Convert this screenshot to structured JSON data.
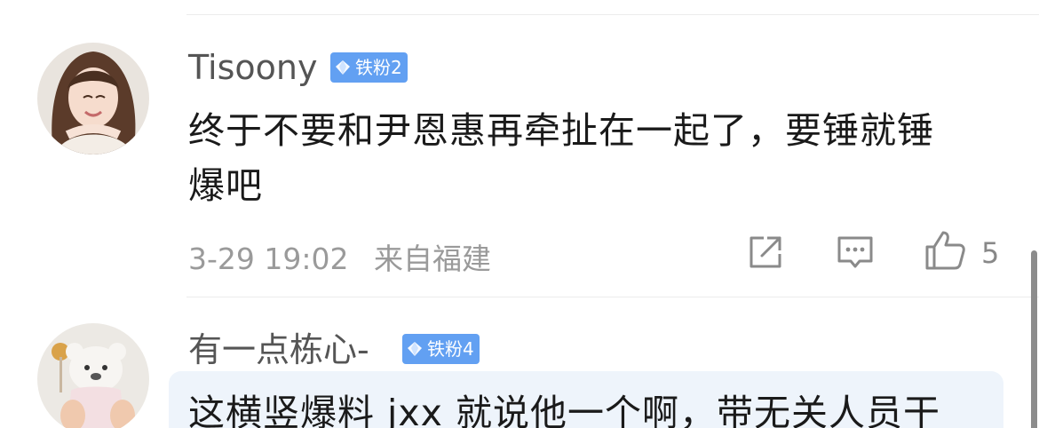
{
  "comments": [
    {
      "username": "Tisoony",
      "badge": "铁粉2",
      "text_line1": "终于不要和尹恩惠再牵扯在一起了，要锤就锤",
      "text_line2": "爆吧",
      "date": "3-29 19:02",
      "location": "来自福建",
      "likes": "5"
    },
    {
      "username": "有一点栋心-",
      "badge": "铁粉4",
      "text_line1": "这横竖爆料 jxx 就说他一个啊，带无关人员干"
    }
  ],
  "icons": {
    "share": "share-icon",
    "comment": "comment-icon",
    "like": "like-icon",
    "badge": "diamond-icon"
  },
  "colors": {
    "badge_bg": "#62a0f2",
    "text": "#1a1a1a",
    "meta": "#9a9a9a"
  }
}
